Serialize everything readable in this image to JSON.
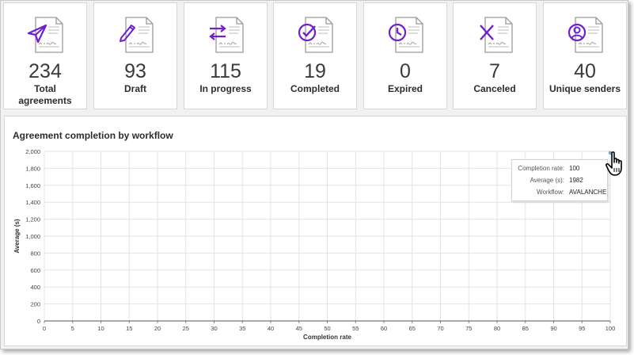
{
  "colors": {
    "accent": "#6e1fcf",
    "grid": "#e3e3e3",
    "point": "#7aa7c7",
    "doc_outline": "#9a9a9a"
  },
  "cards": [
    {
      "icon": "send-icon",
      "value": "234",
      "label": "Total agreements"
    },
    {
      "icon": "draft-pen-icon",
      "value": "93",
      "label": "Draft"
    },
    {
      "icon": "swap-arrows-icon",
      "value": "115",
      "label": "In progress"
    },
    {
      "icon": "check-circle-icon",
      "value": "19",
      "label": "Completed"
    },
    {
      "icon": "clock-icon",
      "value": "0",
      "label": "Expired"
    },
    {
      "icon": "x-cancel-icon",
      "value": "7",
      "label": "Canceled"
    },
    {
      "icon": "user-circle-icon",
      "value": "40",
      "label": "Unique senders"
    }
  ],
  "tooltip": {
    "completion_rate_key": "Completion rate:",
    "completion_rate_val": "100",
    "average_key": "Average (s):",
    "average_val": "1982",
    "workflow_key": "Workflow:",
    "workflow_val": "AVALANCHE"
  },
  "chart_data": {
    "type": "scatter",
    "title": "Agreement completion by workflow",
    "xlabel": "Completion rate",
    "ylabel": "Average (s)",
    "xlim": [
      0,
      100
    ],
    "ylim": [
      0,
      2000
    ],
    "xticks": [
      0,
      5,
      10,
      15,
      20,
      25,
      30,
      35,
      40,
      45,
      50,
      55,
      60,
      65,
      70,
      75,
      80,
      85,
      90,
      95,
      100
    ],
    "ytick_labels": [
      "0",
      "200",
      "400",
      "600",
      "800",
      "1,000",
      "1,200",
      "1,400",
      "1,600",
      "1,800",
      "2,000"
    ],
    "grid": true,
    "points": [
      {
        "x": 100,
        "y": 1982,
        "workflow": "AVALANCHE"
      }
    ]
  }
}
